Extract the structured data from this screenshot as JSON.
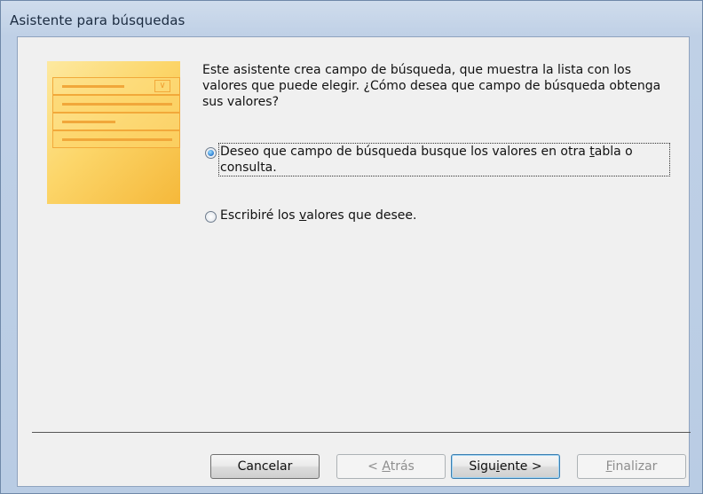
{
  "window": {
    "title": "Asistente para búsquedas"
  },
  "intro": {
    "text": "Este asistente crea campo de búsqueda, que muestra la lista con los valores que puede elegir. ¿Cómo desea que campo de búsqueda obtenga sus valores?"
  },
  "options": [
    {
      "label_pre": "Deseo que campo de búsqueda busque los valores en otra ",
      "label_accel": "t",
      "label_post": "abla o consulta.",
      "selected": true
    },
    {
      "label_pre": "Escribiré los ",
      "label_accel": "v",
      "label_post": "alores que desee.",
      "selected": false
    }
  ],
  "buttons": {
    "cancel": {
      "label": "Cancelar",
      "enabled": true
    },
    "back": {
      "label_pre": "< ",
      "label_accel": "A",
      "label_post": "trás",
      "enabled": false
    },
    "next": {
      "label_pre": "Sigu",
      "label_accel": "i",
      "label_post": "ente >",
      "enabled": true,
      "default": true
    },
    "finish": {
      "label_pre": "",
      "label_accel": "F",
      "label_post": "inalizar",
      "enabled": false
    }
  }
}
